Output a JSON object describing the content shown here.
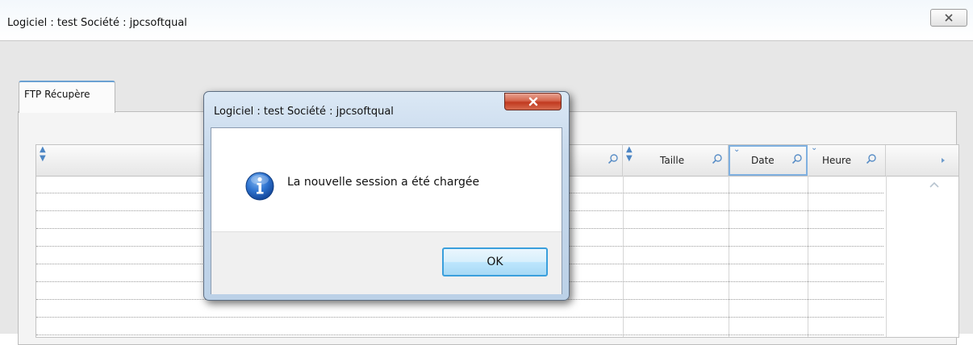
{
  "main_window": {
    "title": "Logiciel : test Société : jpcsoftqual",
    "close_icon": "close-icon"
  },
  "tabs": [
    {
      "label": "FTP Récupère",
      "active": true
    }
  ],
  "grid": {
    "columns": [
      {
        "label": "",
        "sortable": true,
        "filter_icon": "magnifier-icon"
      },
      {
        "label": "Taille",
        "sortable": true,
        "filter_icon": "magnifier-icon"
      },
      {
        "label": "Date",
        "sortable": true,
        "filter_icon": "magnifier-icon",
        "focused": true
      },
      {
        "label": "Heure",
        "sortable": true,
        "filter_icon": "magnifier-icon"
      }
    ],
    "rows": []
  },
  "dialog": {
    "title": "Logiciel : test Société : jpcsoftqual",
    "icon": "info-icon",
    "message": "La nouvelle session  a été chargée",
    "ok_label": "OK"
  },
  "colors": {
    "info_blue": "#1f64c4",
    "close_red": "#c1391f",
    "accent_blue": "#3a9fdc"
  }
}
